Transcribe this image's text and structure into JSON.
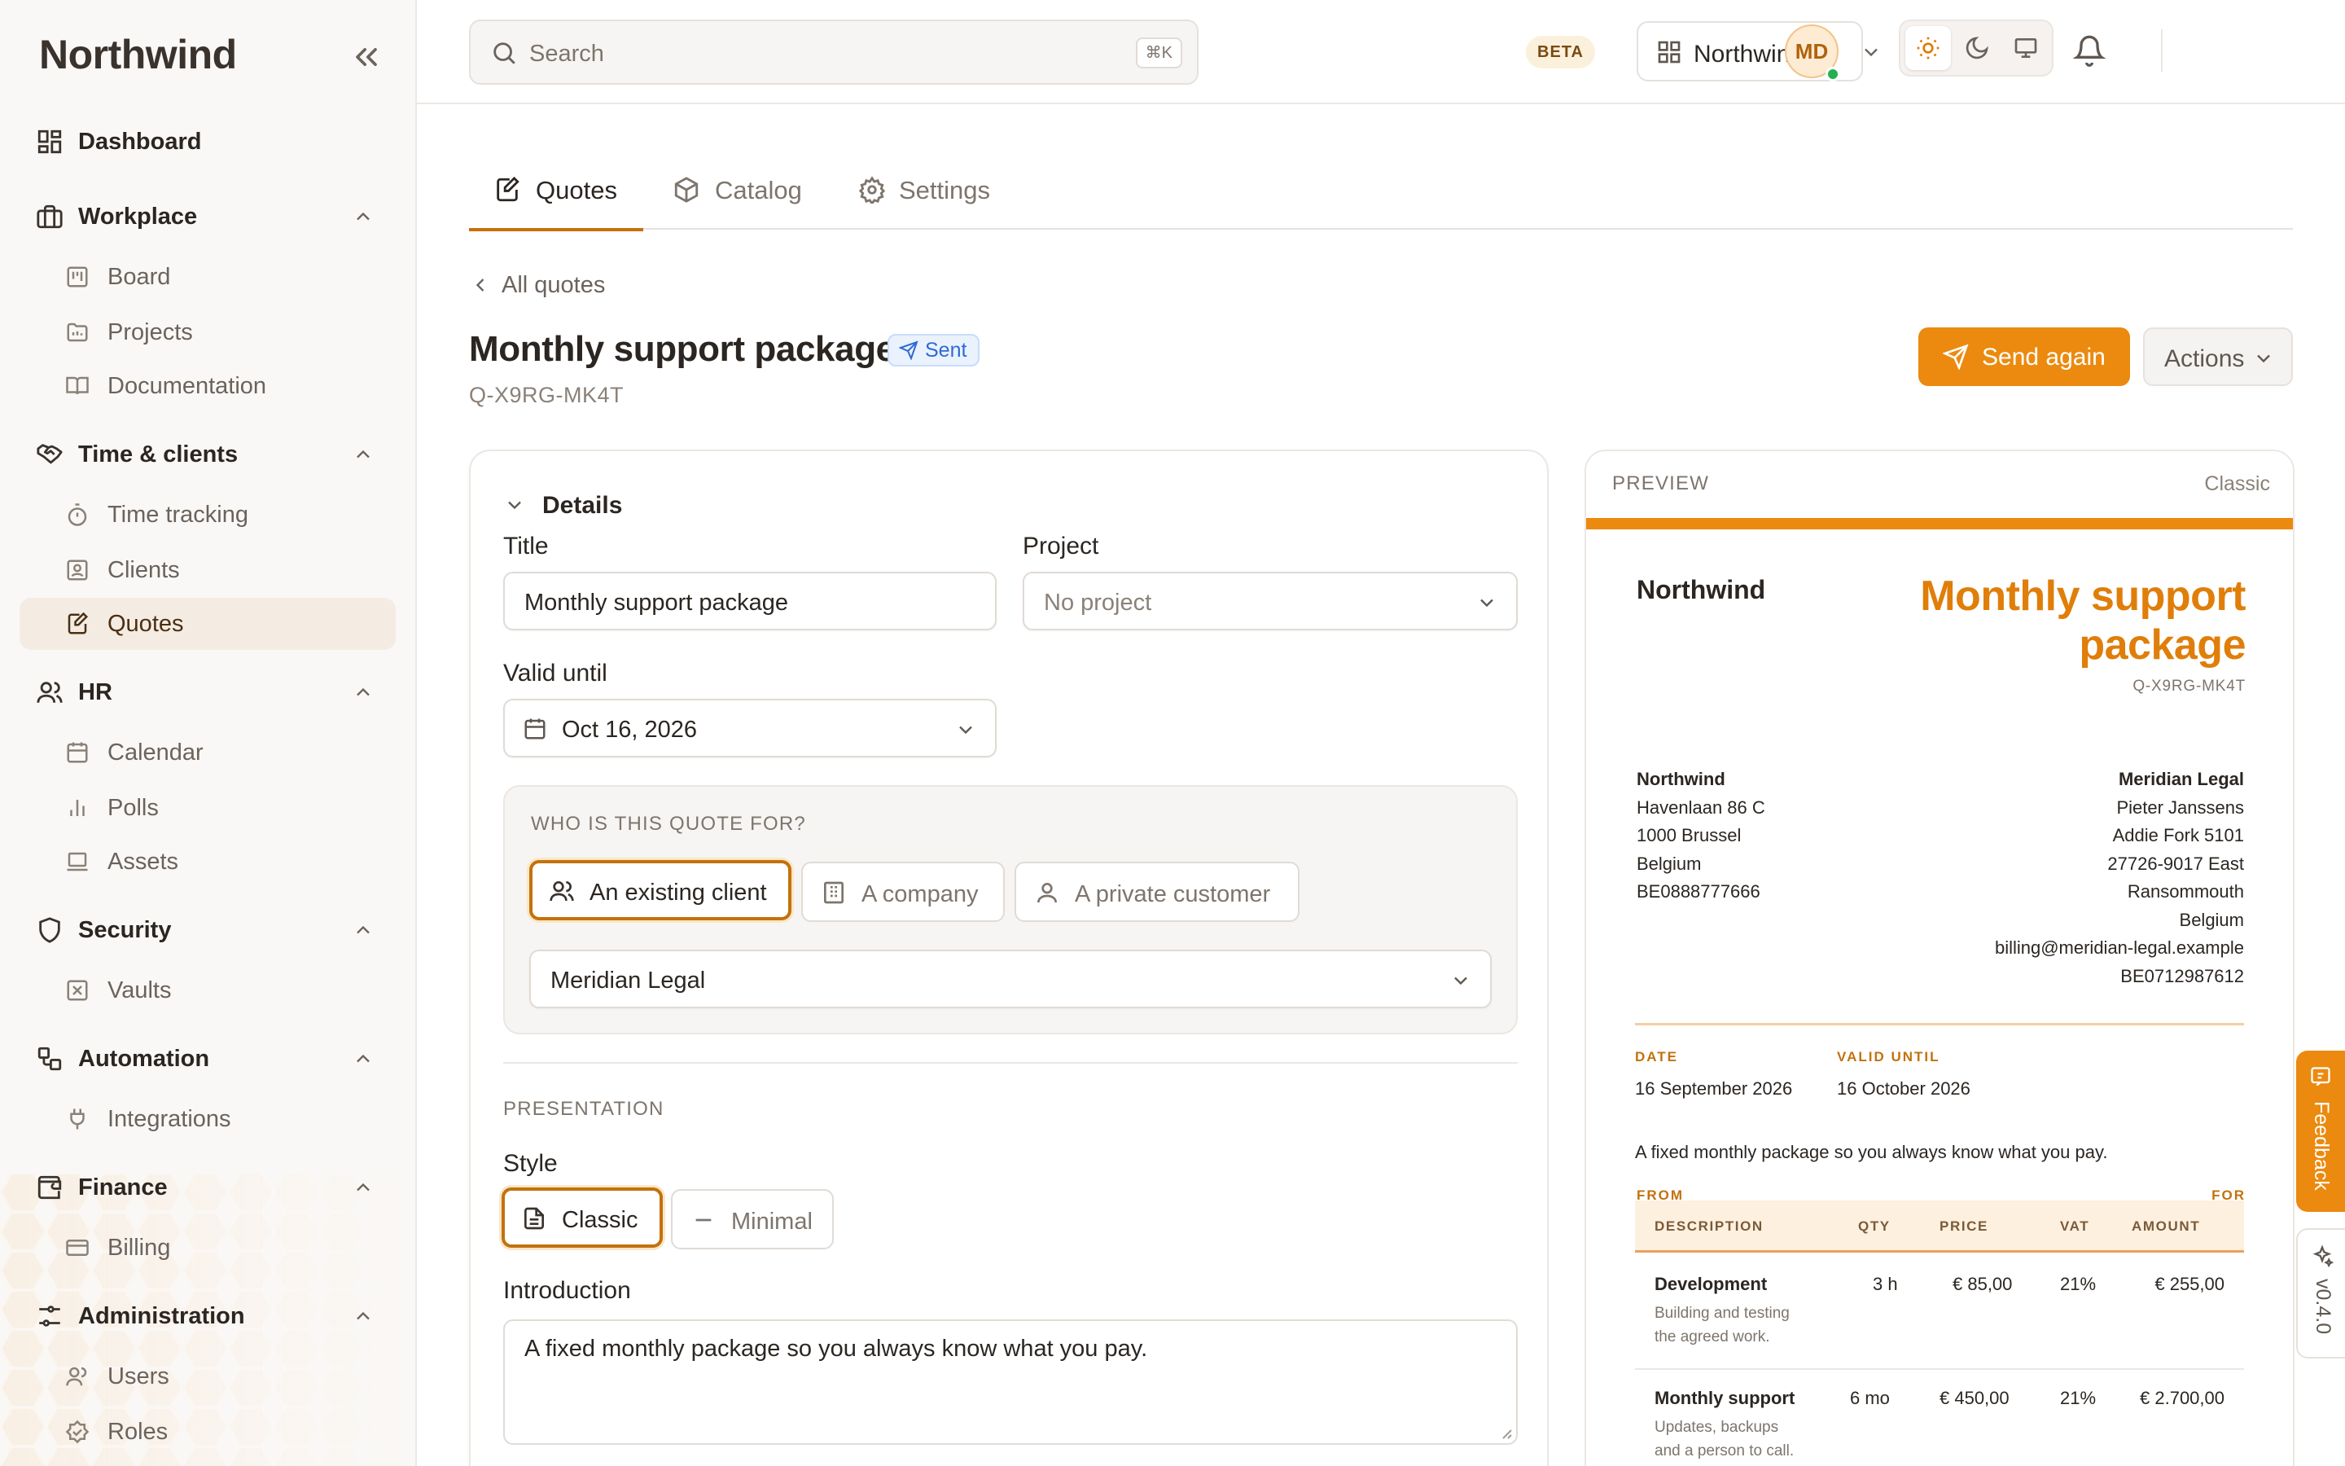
{
  "sidebar": {
    "brand": "Northwind",
    "dashboard": "Dashboard",
    "groups": {
      "workplace": {
        "label": "Workplace",
        "items": [
          "Board",
          "Projects",
          "Documentation"
        ]
      },
      "time": {
        "label": "Time & clients",
        "items": [
          "Time tracking",
          "Clients",
          "Quotes"
        ]
      },
      "hr": {
        "label": "HR",
        "items": [
          "Calendar",
          "Polls",
          "Assets"
        ]
      },
      "security": {
        "label": "Security",
        "items": [
          "Vaults"
        ]
      },
      "automation": {
        "label": "Automation",
        "items": [
          "Integrations"
        ]
      },
      "finance": {
        "label": "Finance",
        "items": [
          "Billing"
        ]
      },
      "administration": {
        "label": "Administration",
        "items": [
          "Users",
          "Roles"
        ]
      }
    },
    "active_item": "Quotes"
  },
  "topbar": {
    "search_placeholder": "Search",
    "search_shortcut": "⌘K",
    "beta_badge": "BETA",
    "workspace": "Northwind",
    "theme_active": "light",
    "avatar_initials": "MD",
    "online_status_color": "#22b14c"
  },
  "tabs": [
    {
      "label": "Quotes",
      "icon": "edit-document-icon",
      "active": true
    },
    {
      "label": "Catalog",
      "icon": "box-icon",
      "active": false
    },
    {
      "label": "Settings",
      "icon": "gear-icon",
      "active": false
    }
  ],
  "header": {
    "back_label": "All quotes",
    "title": "Monthly support package",
    "status": "Sent",
    "quote_number": "Q-X9RG-MK4T",
    "primary_action": "Send again",
    "secondary_action": "Actions"
  },
  "form": {
    "section_title": "Details",
    "title_label": "Title",
    "title_value": "Monthly support package",
    "project_label": "Project",
    "project_value": "No project",
    "valid_until_label": "Valid until",
    "valid_until_value": "Oct 16, 2026",
    "recipient_heading": "WHO IS THIS QUOTE FOR?",
    "recipient_options": [
      "An existing client",
      "A company",
      "A private customer"
    ],
    "recipient_selected": "An existing client",
    "client_value": "Meridian Legal",
    "presentation_heading": "PRESENTATION",
    "style_label": "Style",
    "style_options": [
      "Classic",
      "Minimal"
    ],
    "style_selected": "Classic",
    "intro_label": "Introduction",
    "intro_value": "A fixed monthly package so you always know what you pay."
  },
  "preview": {
    "label": "PREVIEW",
    "style_name": "Classic",
    "accent_color": "#eb8a0f",
    "company": "Northwind",
    "title": "Monthly support package",
    "number": "Q-X9RG-MK4T",
    "from_label": "FROM",
    "from_lines": [
      "Northwind",
      "Havenlaan 86 C",
      "1000 Brussel",
      "Belgium",
      "BE0888777666"
    ],
    "for_label": "FOR",
    "for_lines": [
      "Meridian Legal",
      "Pieter Janssens",
      "Addie Fork 5101",
      "27726-9017 East",
      "Ransommouth",
      "Belgium",
      "billing@meridian-legal.example",
      "BE0712987612"
    ],
    "date_label": "DATE",
    "date_value": "16 September 2026",
    "valid_label": "VALID UNTIL",
    "valid_value": "16 October 2026",
    "intro": "A fixed monthly package so you always know what you pay.",
    "table_headers": [
      "DESCRIPTION",
      "QTY",
      "PRICE",
      "VAT",
      "AMOUNT"
    ],
    "rows": [
      {
        "name": "Development",
        "desc_lines": [
          "Building and testing",
          "the agreed work."
        ],
        "qty": "3 h",
        "price": "€ 85,00",
        "vat": "21%",
        "amount": "€ 255,00"
      },
      {
        "name": "Monthly support",
        "desc_lines": [
          "Updates, backups",
          "and a person to call."
        ],
        "qty": "6 mo",
        "price": "€ 450,00",
        "vat": "21%",
        "amount": "€ 2.700,00"
      }
    ]
  },
  "side_tabs": {
    "feedback": "Feedback",
    "version": "v0.4.0"
  },
  "colors": {
    "accent": "#eb8a0f",
    "accent_dark": "#c2720d",
    "status_sent": "#2f6ad3"
  }
}
